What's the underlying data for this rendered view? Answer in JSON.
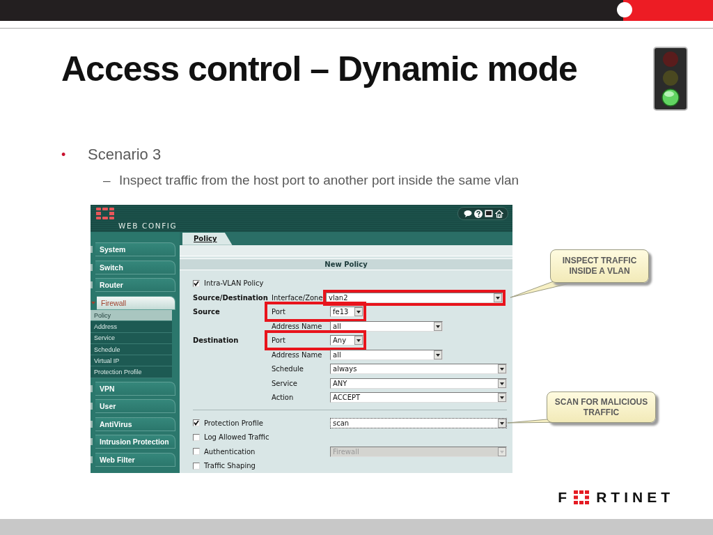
{
  "slide": {
    "title": "Access control – Dynamic mode",
    "bullets": [
      {
        "marker": "•",
        "text": "Scenario 3",
        "children": [
          {
            "marker": "–",
            "text": "Inspect traffic from the host port to another port inside the same vlan"
          }
        ]
      }
    ]
  },
  "app": {
    "brand": "WEB CONFIG",
    "sidebar": [
      {
        "label": "System",
        "expanded": false
      },
      {
        "label": "Switch",
        "expanded": false
      },
      {
        "label": "Router",
        "expanded": false
      },
      {
        "label": "Firewall",
        "expanded": true,
        "children": [
          {
            "label": "Policy",
            "selected": true
          },
          {
            "label": "Address",
            "selected": false
          },
          {
            "label": "Service",
            "selected": false
          },
          {
            "label": "Schedule",
            "selected": false
          },
          {
            "label": "Virtual IP",
            "selected": false
          },
          {
            "label": "Protection Profile",
            "selected": false
          }
        ]
      },
      {
        "label": "VPN",
        "expanded": false
      },
      {
        "label": "User",
        "expanded": false
      },
      {
        "label": "AntiVirus",
        "expanded": false
      },
      {
        "label": "Intrusion Protection",
        "expanded": false
      },
      {
        "label": "Web Filter",
        "expanded": false
      }
    ],
    "tabs": [
      {
        "label": "Policy",
        "selected": true
      }
    ],
    "panel_title": "New Policy",
    "form": [
      {
        "kind": "checkbox",
        "label": "Intra-VLAN Policy",
        "checked": true
      },
      {
        "kind": "select",
        "group": "Source/Destination",
        "label": "Interface/Zone",
        "value": "vlan2",
        "highlighted": true
      },
      {
        "kind": "short-select",
        "group": "Source",
        "label": "Port",
        "value": "fe13",
        "highlighted": true
      },
      {
        "kind": "medium-select",
        "label": "Address Name",
        "value": "all",
        "highlighted": false
      },
      {
        "kind": "short-select",
        "group": "Destination",
        "label": "Port",
        "value": "Any",
        "highlighted": true
      },
      {
        "kind": "medium-select",
        "label": "Address Name",
        "value": "all",
        "highlighted": false
      },
      {
        "kind": "select",
        "label": "Schedule",
        "value": "always",
        "highlighted": false
      },
      {
        "kind": "select",
        "label": "Service",
        "value": "ANY",
        "highlighted": false
      },
      {
        "kind": "select",
        "label": "Action",
        "value": "ACCEPT",
        "highlighted": false
      },
      {
        "kind": "divider"
      },
      {
        "kind": "checkbox",
        "label": "Protection Profile",
        "checked": true,
        "value": "scan",
        "focused": true
      },
      {
        "kind": "checkbox",
        "label": "Log Allowed Traffic",
        "checked": false
      },
      {
        "kind": "checkbox",
        "label": "Authentication",
        "checked": false,
        "value": "Firewall",
        "disabled": true
      },
      {
        "kind": "checkbox",
        "label": "Traffic Shaping",
        "checked": false
      }
    ]
  },
  "callouts": [
    {
      "text": "INSPECT TRAFFIC INSIDE A VLAN"
    },
    {
      "text": "SCAN FOR MALICIOUS TRAFFIC"
    }
  ],
  "logo": {
    "before": "F",
    "after": "RTINET"
  }
}
